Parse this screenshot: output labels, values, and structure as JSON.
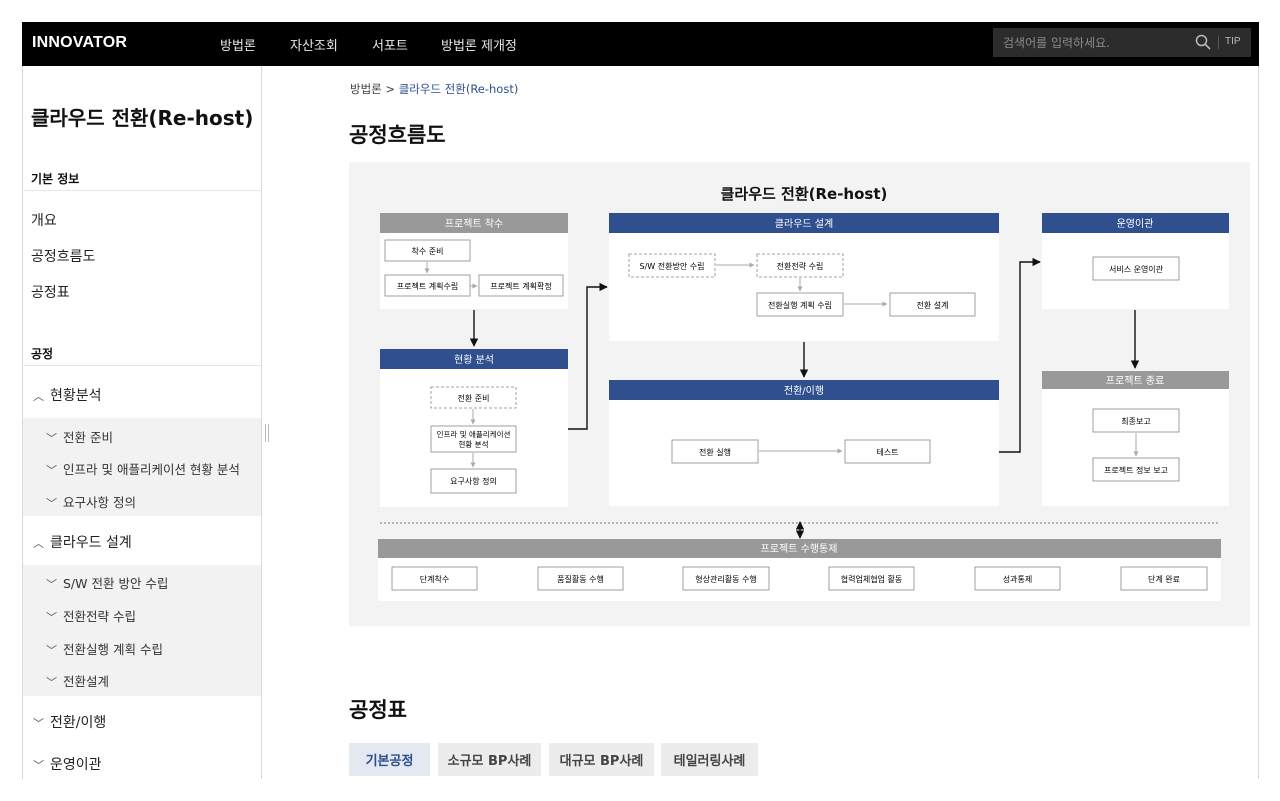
{
  "header": {
    "logo": "INNOVATOR",
    "nav": [
      "방법론",
      "자산조회",
      "서포트",
      "방법론 제개정"
    ],
    "search_placeholder": "검색어를 입력하세요.",
    "tip_label": "TIP"
  },
  "sidebar": {
    "title": "클라우드 전환(Re-host)",
    "basic_info_label": "기본 정보",
    "basic_links": [
      "개요",
      "공정흐름도",
      "공정표"
    ],
    "process_label": "공정",
    "groups": [
      {
        "label": "현황분석",
        "expanded": true,
        "items": [
          "전환 준비",
          "인프라 및 애플리케이션 현황 분석",
          "요구사항 정의"
        ]
      },
      {
        "label": "클라우드 설계",
        "expanded": true,
        "items": [
          "S/W 전환 방안 수립",
          "전환전략 수립",
          "전환실행 계획 수립",
          "전환설계"
        ]
      },
      {
        "label": "전환/이행",
        "expanded": false,
        "items": []
      },
      {
        "label": "운영이관",
        "expanded": false,
        "items": []
      }
    ]
  },
  "main": {
    "breadcrumb": [
      "방법론",
      "클라우드 전환(Re-host)"
    ],
    "page_title": "공정흐름도",
    "section2_title": "공정표",
    "tabs": [
      "기본공정",
      "소규모 BP사례",
      "대규모 BP사례",
      "테일러링사례"
    ]
  },
  "diagram": {
    "title": "클라우드 전환(Re-host)",
    "phases": {
      "start": {
        "title": "프로젝트 착수",
        "steps": [
          "착수 준비",
          "프로젝트 계획수립",
          "프로젝트 계획확정"
        ]
      },
      "analysis": {
        "title": "현황 분석",
        "steps": [
          "전환 준비",
          "인프라 및 애플리케이션",
          "현황 분석",
          "요구사항 정의"
        ]
      },
      "design": {
        "title": "클라우드 설계",
        "steps": [
          "S/W 전환방안 수립",
          "전환전략 수립",
          "전환실행 계획 수립",
          "전환 설계"
        ]
      },
      "migration": {
        "title": "전환/이행",
        "steps": [
          "전환 실행",
          "테스트"
        ]
      },
      "operation": {
        "title": "운영이관",
        "steps": [
          "서비스 운영이관"
        ]
      },
      "closing": {
        "title": "프로젝트 종료",
        "steps": [
          "최종보고",
          "프로젝트 정보 보고"
        ]
      }
    },
    "control": {
      "title": "프로젝트 수행통제",
      "steps": [
        "단계착수",
        "품질활동 수행",
        "형상관리활동 수행",
        "협력업체협업 활동",
        "성과통제",
        "단계 완료"
      ]
    },
    "colors": {
      "gray_header": "#999999",
      "blue_header": "#2f4f8f"
    }
  }
}
